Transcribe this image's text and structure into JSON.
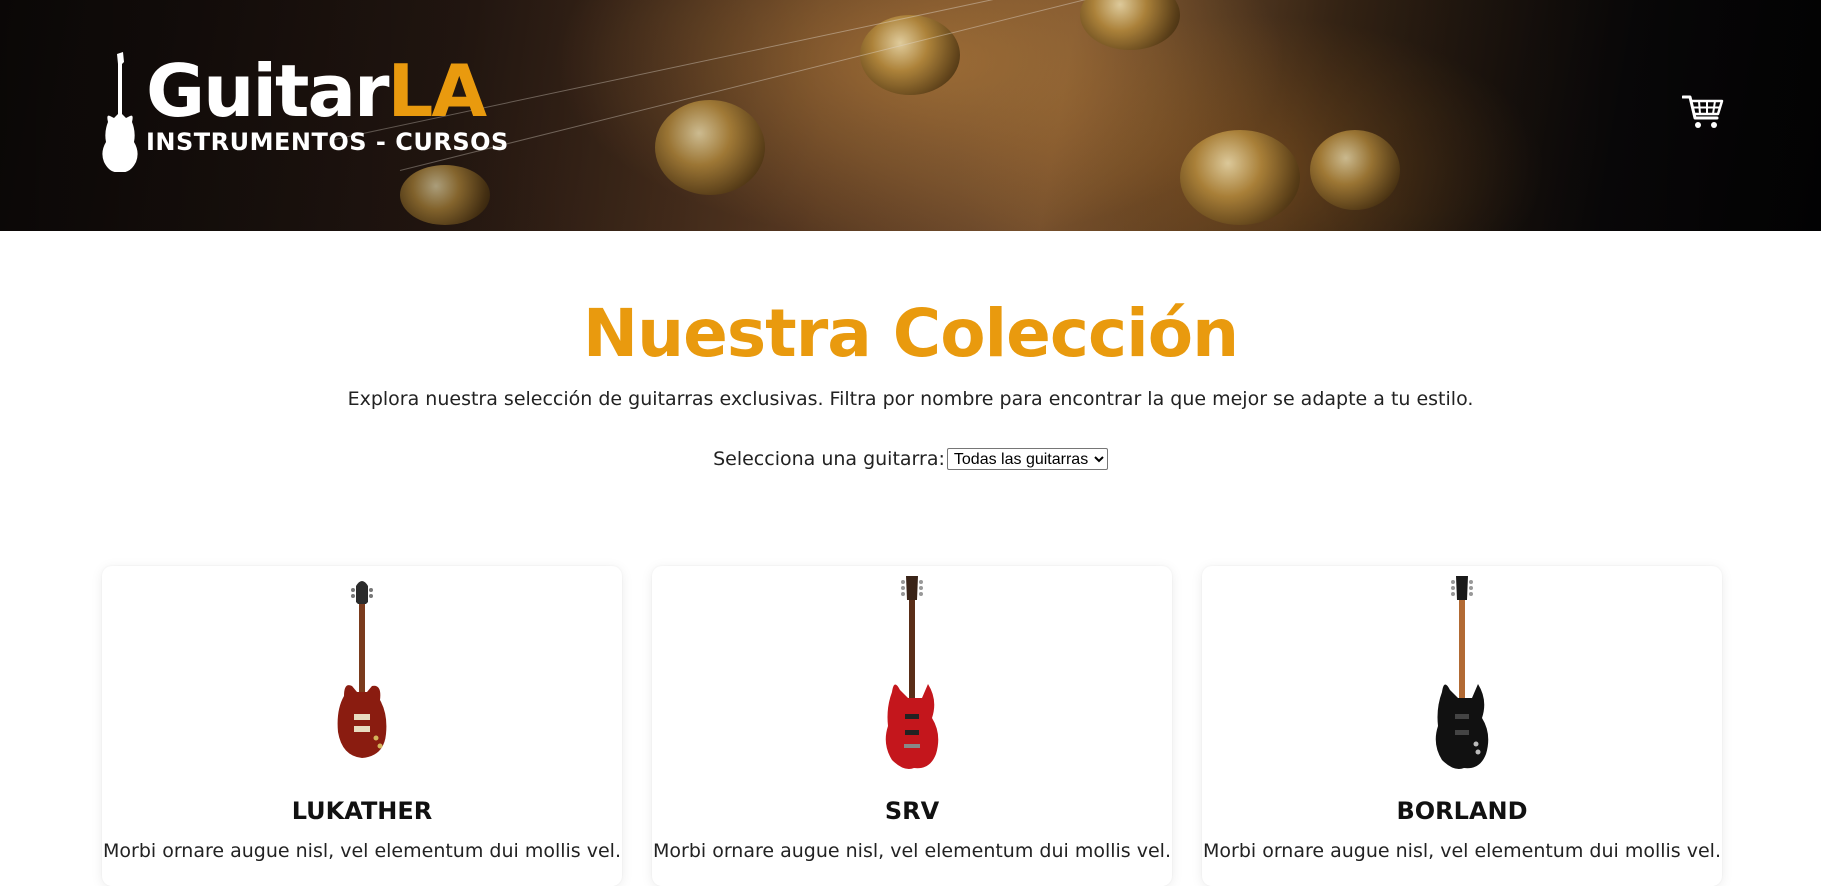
{
  "header": {
    "logo": {
      "name_main": "Guitar",
      "name_accent": "LA",
      "tagline": "INSTRUMENTOS - CURSOS"
    },
    "cart_icon": "shopping-cart-icon"
  },
  "main": {
    "title": "Nuestra Colección",
    "intro": "Explora nuestra selección de guitarras exclusivas. Filtra por nombre para encontrar la que mejor se adapte a tu estilo.",
    "filter": {
      "label": "Selecciona una guitarra:",
      "selected": "Todas las guitarras"
    }
  },
  "products": [
    {
      "name": "LUKATHER",
      "description": "Morbi ornare augue nisl, vel elementum dui mollis vel.",
      "image": "les-paul-guitar-red",
      "body_color": "#8a1c10"
    },
    {
      "name": "SRV",
      "description": "Morbi ornare augue nisl, vel elementum dui mollis vel.",
      "image": "superstrat-guitar-red",
      "body_color": "#c4161c"
    },
    {
      "name": "BORLAND",
      "description": "Morbi ornare augue nisl, vel elementum dui mollis vel.",
      "image": "superstrat-guitar-black",
      "body_color": "#111111"
    }
  ],
  "colors": {
    "accent": "#e99a0e",
    "text": "#222222"
  }
}
